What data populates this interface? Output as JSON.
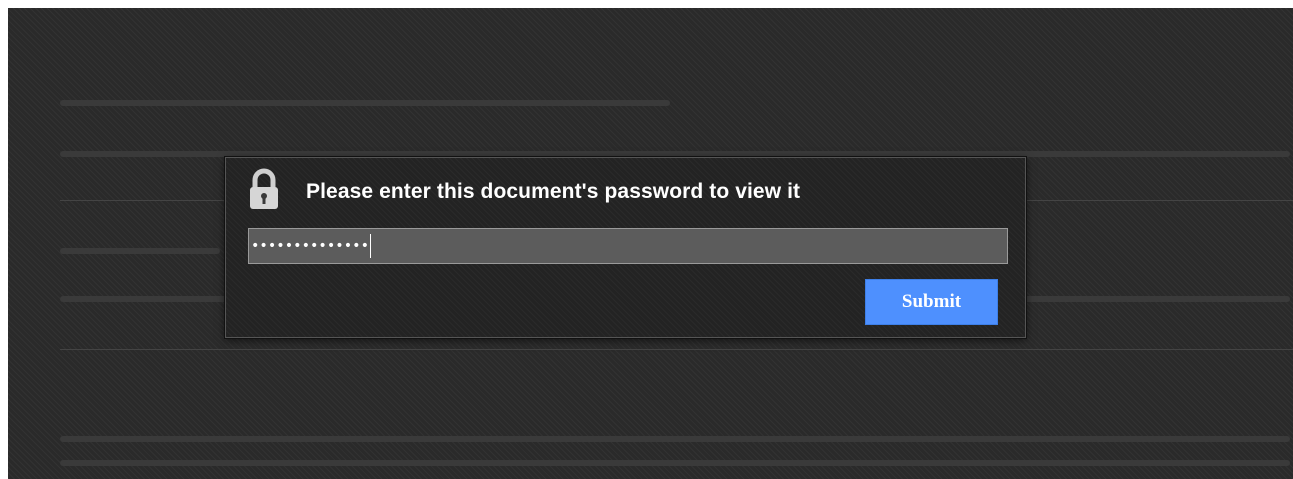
{
  "dialog": {
    "title": "Please enter this document's password to view it",
    "password_value": "••••••••••••••",
    "submit_label": "Submit",
    "lock_icon": "padlock-icon"
  },
  "colors": {
    "background": "#2a2a2a",
    "dialog_bg": "#232323",
    "field_bg": "#5c5c5c",
    "button_bg": "#4e90fe",
    "text": "#ffffff"
  }
}
